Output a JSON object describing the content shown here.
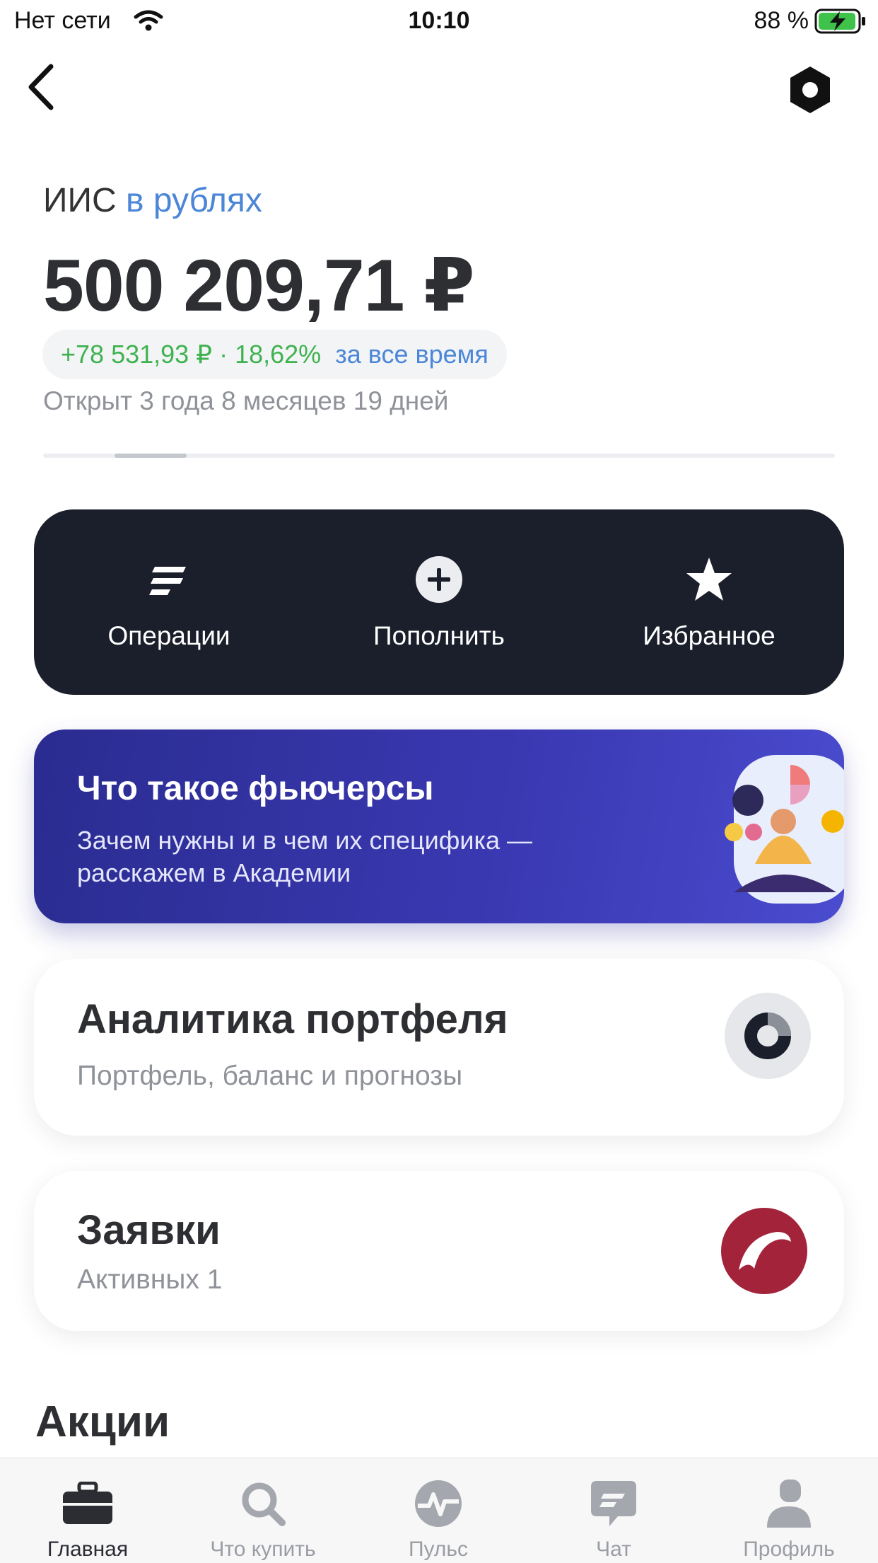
{
  "status_bar": {
    "carrier": "Нет сети",
    "time": "10:10",
    "battery": "88 %"
  },
  "icons": {
    "back": "chevron-left-icon",
    "settings": "hexagon-settings-icon",
    "operations": "list-lines-icon",
    "topup": "plus-circle-icon",
    "favorites": "star-icon",
    "analytics": "donut-chart-icon",
    "orders": "dolphin-icon"
  },
  "account": {
    "title": "ИИС",
    "currency_link": "в рублях",
    "balance": "500 209,71 ₽",
    "gain": "+78 531,93 ₽ · 18,62%",
    "period": "за все время",
    "opened": "Открыт 3 года 8 месяцев 19 дней"
  },
  "actions": {
    "operations": "Операции",
    "topup": "Пополнить",
    "favorites": "Избранное"
  },
  "promo": {
    "title": "Что такое фьючерсы",
    "subtitle": "Зачем нужны и в чем их специфика — расскажем в Академии"
  },
  "analytics_card": {
    "title": "Аналитика портфеля",
    "subtitle": "Портфель, баланс и прогнозы"
  },
  "orders_card": {
    "title": "Заявки",
    "subtitle": "Активных 1"
  },
  "section": {
    "title": "Акции"
  },
  "tabs": [
    {
      "label": "Главная",
      "icon": "briefcase-icon",
      "active": true
    },
    {
      "label": "Что купить",
      "icon": "search-icon",
      "active": false
    },
    {
      "label": "Пульс",
      "icon": "pulse-icon",
      "active": false
    },
    {
      "label": "Чат",
      "icon": "chat-icon",
      "active": false
    },
    {
      "label": "Профиль",
      "icon": "profile-icon",
      "active": false
    }
  ],
  "colors": {
    "accent_blue": "#4b86d8",
    "gain_green": "#3fb24f",
    "panel_dark": "#1b1f2b",
    "promo_blue": "#3b39b3",
    "orders_red": "#a3233a"
  }
}
